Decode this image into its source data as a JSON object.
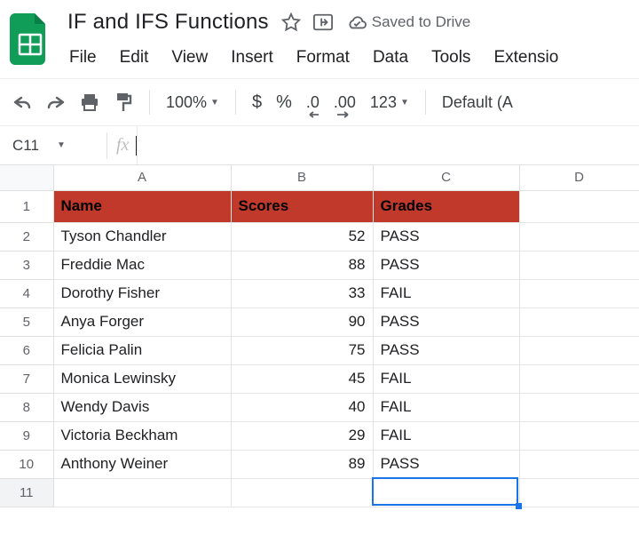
{
  "header": {
    "doc_title": "IF and IFS Functions",
    "saved_text": "Saved to Drive"
  },
  "menu": {
    "file": "File",
    "edit": "Edit",
    "view": "View",
    "insert": "Insert",
    "format": "Format",
    "data": "Data",
    "tools": "Tools",
    "extensions": "Extensio"
  },
  "toolbar": {
    "zoom": "100%",
    "currency": "$",
    "percent": "%",
    "dec_dec": ".0",
    "dec_inc": ".00",
    "num_fmt": "123",
    "font": "Default (A"
  },
  "formula_bar": {
    "name_box": "C11",
    "fx_label": "fx",
    "formula": ""
  },
  "grid": {
    "columns": [
      "A",
      "B",
      "C",
      "D"
    ],
    "rows": [
      "1",
      "2",
      "3",
      "4",
      "5",
      "6",
      "7",
      "8",
      "9",
      "10",
      "11"
    ],
    "headers": {
      "A": "Name",
      "B": "Scores",
      "C": "Grades"
    },
    "data": [
      {
        "name": "Tyson Chandler",
        "score": "52",
        "grade": "PASS"
      },
      {
        "name": "Freddie Mac",
        "score": "88",
        "grade": "PASS"
      },
      {
        "name": "Dorothy Fisher",
        "score": "33",
        "grade": " FAIL"
      },
      {
        "name": "Anya Forger",
        "score": "90",
        "grade": "PASS"
      },
      {
        "name": "Felicia Palin",
        "score": "75",
        "grade": "PASS"
      },
      {
        "name": "Monica Lewinsky",
        "score": "45",
        "grade": "FAIL"
      },
      {
        "name": "Wendy Davis",
        "score": "40",
        "grade": "FAIL"
      },
      {
        "name": "Victoria Beckham",
        "score": "29",
        "grade": "FAIL"
      },
      {
        "name": "Anthony Weiner",
        "score": "89",
        "grade": " PASS"
      }
    ],
    "selected_cell": "C11"
  },
  "colors": {
    "header_row_bg": "#c0392b",
    "selection": "#1a73e8"
  }
}
